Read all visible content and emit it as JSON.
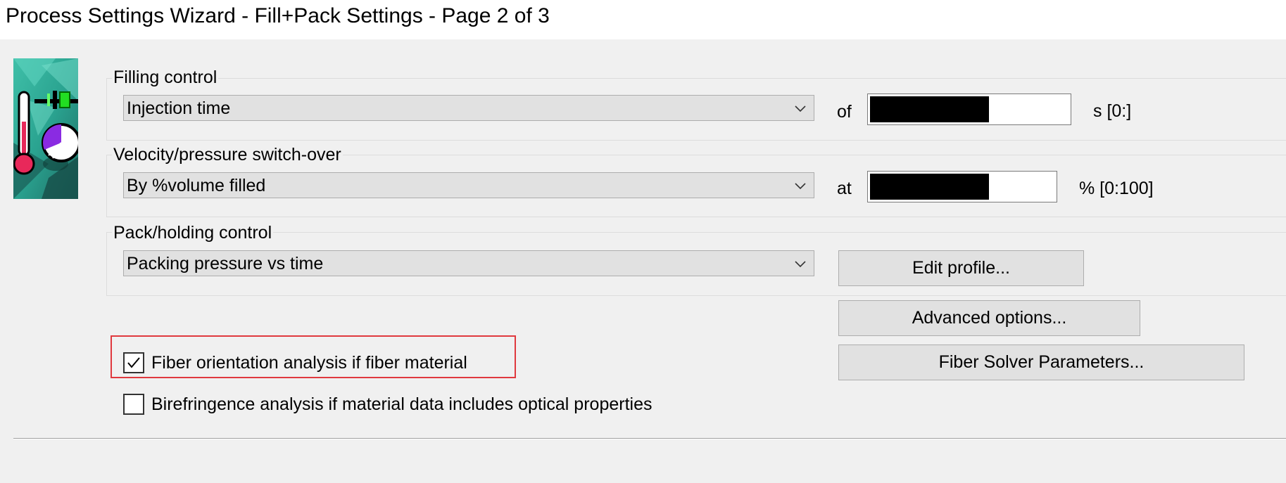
{
  "window": {
    "title": "Process Settings Wizard - Fill+Pack Settings - Page 2 of 3"
  },
  "filling_control": {
    "group_label": "Filling control",
    "selected": "Injection time",
    "connector": "of",
    "value": "",
    "unit_range": "s [0:]"
  },
  "switch_over": {
    "group_label": "Velocity/pressure switch-over",
    "selected": "By %volume filled",
    "connector": "at",
    "value": "",
    "unit_range": "% [0:100]"
  },
  "pack_holding": {
    "group_label": "Pack/holding control",
    "selected": "Packing pressure vs time",
    "edit_profile_label": "Edit profile..."
  },
  "buttons": {
    "advanced_options_label": "Advanced options...",
    "fiber_solver_label": "Fiber Solver Parameters..."
  },
  "options": {
    "fiber_orientation": {
      "label": "Fiber orientation analysis if fiber material",
      "checked": true
    },
    "birefringence": {
      "label": "Birefringence analysis if material data includes optical properties",
      "checked": false
    }
  },
  "colors": {
    "highlight": "#e0393e",
    "background": "#f0f0f0",
    "button_face": "#e1e1e1"
  },
  "icons": {
    "wizard_image": "thermometer-pressure-gauge-image",
    "combo_arrow": "chevron-down-icon",
    "check": "check-icon"
  }
}
